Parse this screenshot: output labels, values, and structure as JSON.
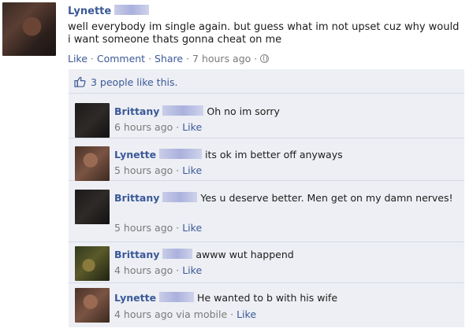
{
  "post": {
    "author": "Lynette",
    "text": "well everybody im single again. but guess what im not upset cuz why would i want someone thats gonna cheat on me",
    "actions": {
      "like": "Like",
      "comment": "Comment",
      "share": "Share",
      "time": "7 hours ago"
    },
    "icon": "globe-icon"
  },
  "likes": {
    "text": "3 people like this.",
    "icon": "thumbs-up-icon"
  },
  "comments": [
    {
      "author": "Brittany",
      "text": "Oh no im sorry",
      "time": "6 hours ago",
      "like": "Like"
    },
    {
      "author": "Lynette",
      "text": "its ok im better off anyways",
      "time": "5 hours ago",
      "like": "Like"
    },
    {
      "author": "Brittany",
      "text": "Yes u deserve better. Men get on my damn nerves!",
      "time": "5 hours ago",
      "like": "Like"
    },
    {
      "author": "Brittany",
      "text": "awww wut happend",
      "time": "4 hours ago",
      "like": "Like"
    },
    {
      "author": "Lynette",
      "text": "He wanted to b with his wife",
      "time": "4 hours ago via mobile",
      "like": "Like"
    }
  ],
  "colors": {
    "link": "#3b5998",
    "comment_bg": "#edeff4",
    "meta": "#7a7a7a"
  }
}
